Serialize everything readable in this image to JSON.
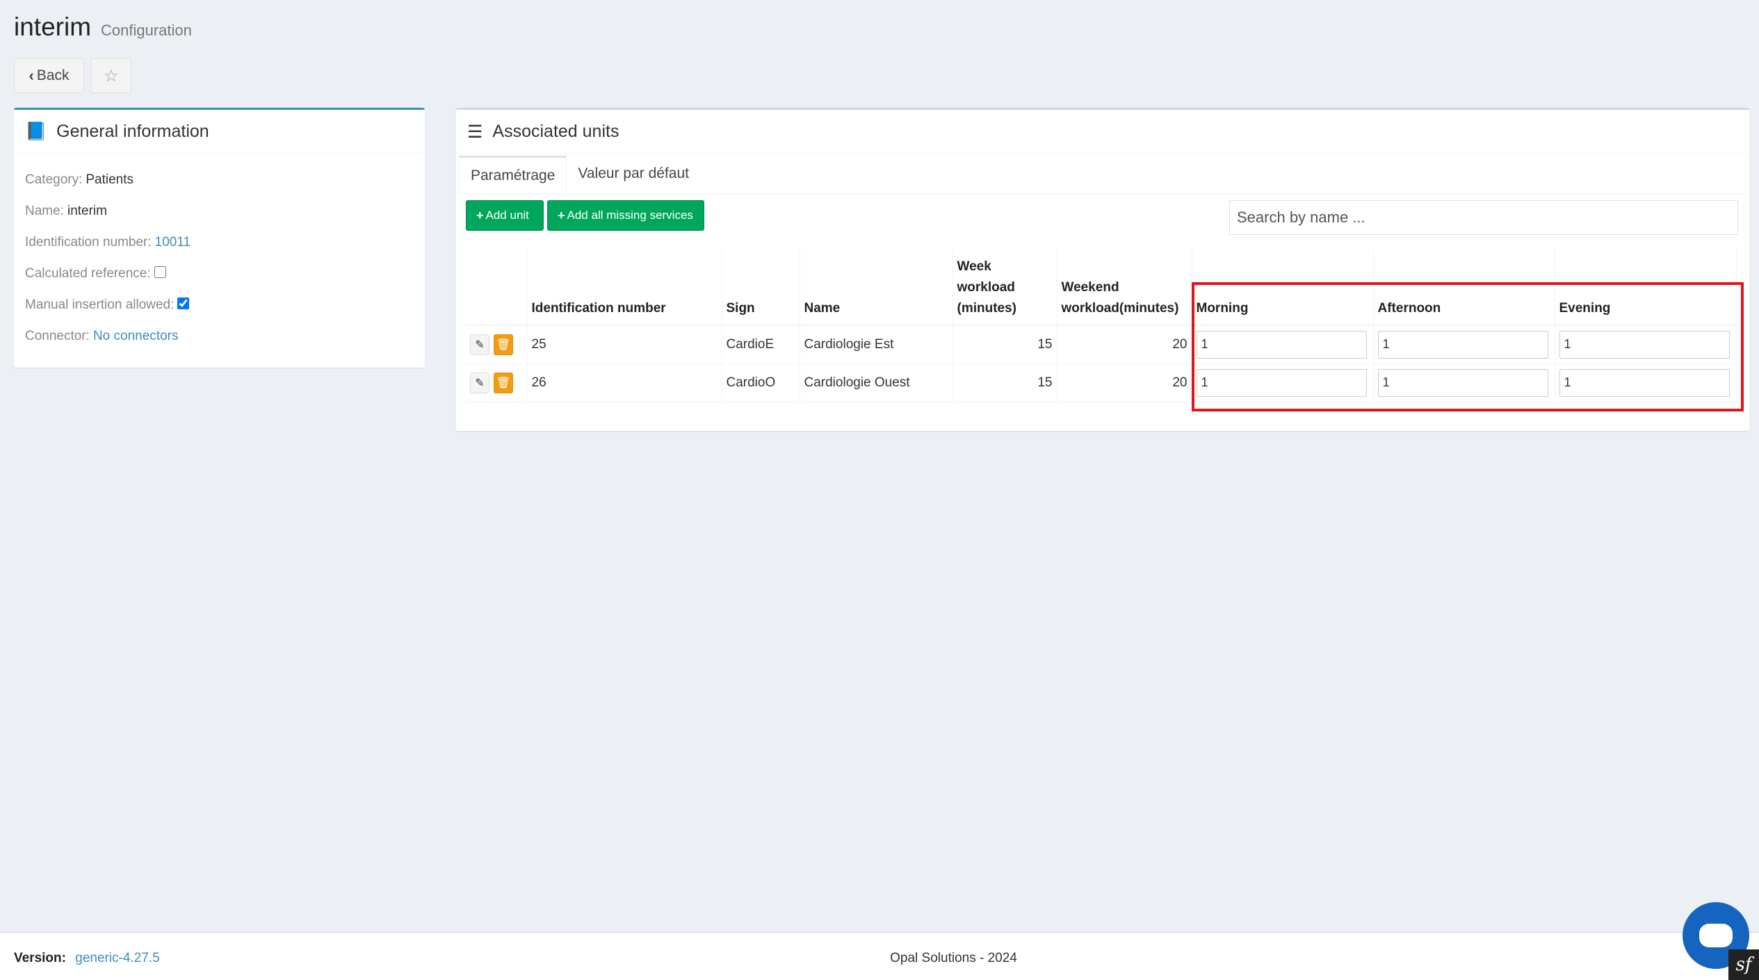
{
  "header": {
    "title": "interim",
    "subtitle": "Configuration",
    "back_label": "Back"
  },
  "general": {
    "title": "General information",
    "category_label": "Category:",
    "category_value": "Patients",
    "name_label": "Name:",
    "name_value": "interim",
    "id_label": "Identification number:",
    "id_value": "10011",
    "calc_ref_label": "Calculated reference:",
    "manual_label": "Manual insertion allowed:",
    "connector_label": "Connector:",
    "connector_value": "No connectors"
  },
  "units": {
    "title": "Associated units",
    "tabs": [
      {
        "label": "Paramétrage"
      },
      {
        "label": "Valeur par défaut"
      }
    ],
    "add_unit_label": "Add unit",
    "add_all_label": "Add all missing services",
    "search_placeholder": "Search by name ...",
    "columns": {
      "id": "Identification number",
      "sign": "Sign",
      "name": "Name",
      "week_1": "Week",
      "week_2": "workload",
      "week_3": "(minutes)",
      "weekend_1": "Weekend",
      "weekend_2": "workload(minutes)",
      "morning": "Morning",
      "afternoon": "Afternoon",
      "evening": "Evening"
    },
    "rows": [
      {
        "id": "25",
        "sign": "CardioE",
        "name": "Cardiologie Est",
        "week": "15",
        "weekend": "20",
        "morning": "1",
        "afternoon": "1",
        "evening": "1"
      },
      {
        "id": "26",
        "sign": "CardioO",
        "name": "Cardiologie Ouest",
        "week": "15",
        "weekend": "20",
        "morning": "1",
        "afternoon": "1",
        "evening": "1"
      }
    ]
  },
  "footer": {
    "version_label": "Version:",
    "version_value": "generic-4.27.5",
    "copyright": "Opal Solutions - 2024"
  },
  "colors": {
    "accent": "#3c8dbc",
    "success": "#00a65a",
    "warning": "#f39c12",
    "highlight": "#e0151f",
    "chat": "#1565c0"
  }
}
